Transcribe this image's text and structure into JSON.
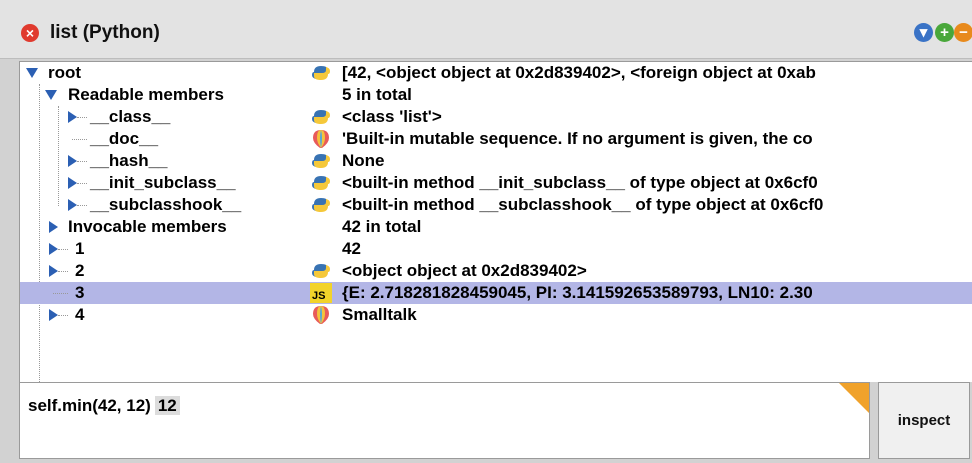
{
  "window": {
    "title": "list (Python)"
  },
  "tree": {
    "rows": [
      {
        "name": "root",
        "value": "[42, <object object at 0x2d839402>, <foreign object at 0xab",
        "icon": "python-icon"
      },
      {
        "name": "Readable members",
        "value": "5 in total",
        "icon": ""
      },
      {
        "name": "__class__",
        "value": "<class 'list'>",
        "icon": "python-icon"
      },
      {
        "name": "__doc__",
        "value": "'Built-in mutable sequence.  If no argument is given, the co",
        "icon": "balloon-icon"
      },
      {
        "name": "__hash__",
        "value": "None",
        "icon": "python-icon"
      },
      {
        "name": "__init_subclass__",
        "value": "<built-in method __init_subclass__ of type object at 0x6cf0",
        "icon": "python-icon"
      },
      {
        "name": "__subclasshook__",
        "value": "<built-in method __subclasshook__ of type object at 0x6cf0",
        "icon": "python-icon"
      },
      {
        "name": "Invocable members",
        "value": "42 in total",
        "icon": ""
      },
      {
        "name": "1",
        "value": "42",
        "icon": ""
      },
      {
        "name": "2",
        "value": "<object object at 0x2d839402>",
        "icon": "python-icon"
      },
      {
        "name": "3",
        "value": "{E: 2.718281828459045, PI: 3.141592653589793, LN10: 2.30",
        "icon": "js-icon",
        "icon_text": "JS"
      },
      {
        "name": "4",
        "value": "Smalltalk",
        "icon": "balloon-icon"
      }
    ]
  },
  "workspace": {
    "expression": "self.min(42, 12)",
    "result": "12"
  },
  "inspect_button": {
    "label": "inspect"
  },
  "colors": {
    "selection": "#b3b6e6",
    "accent_blue": "#2b5fb3",
    "close_red": "#e03a2e"
  }
}
